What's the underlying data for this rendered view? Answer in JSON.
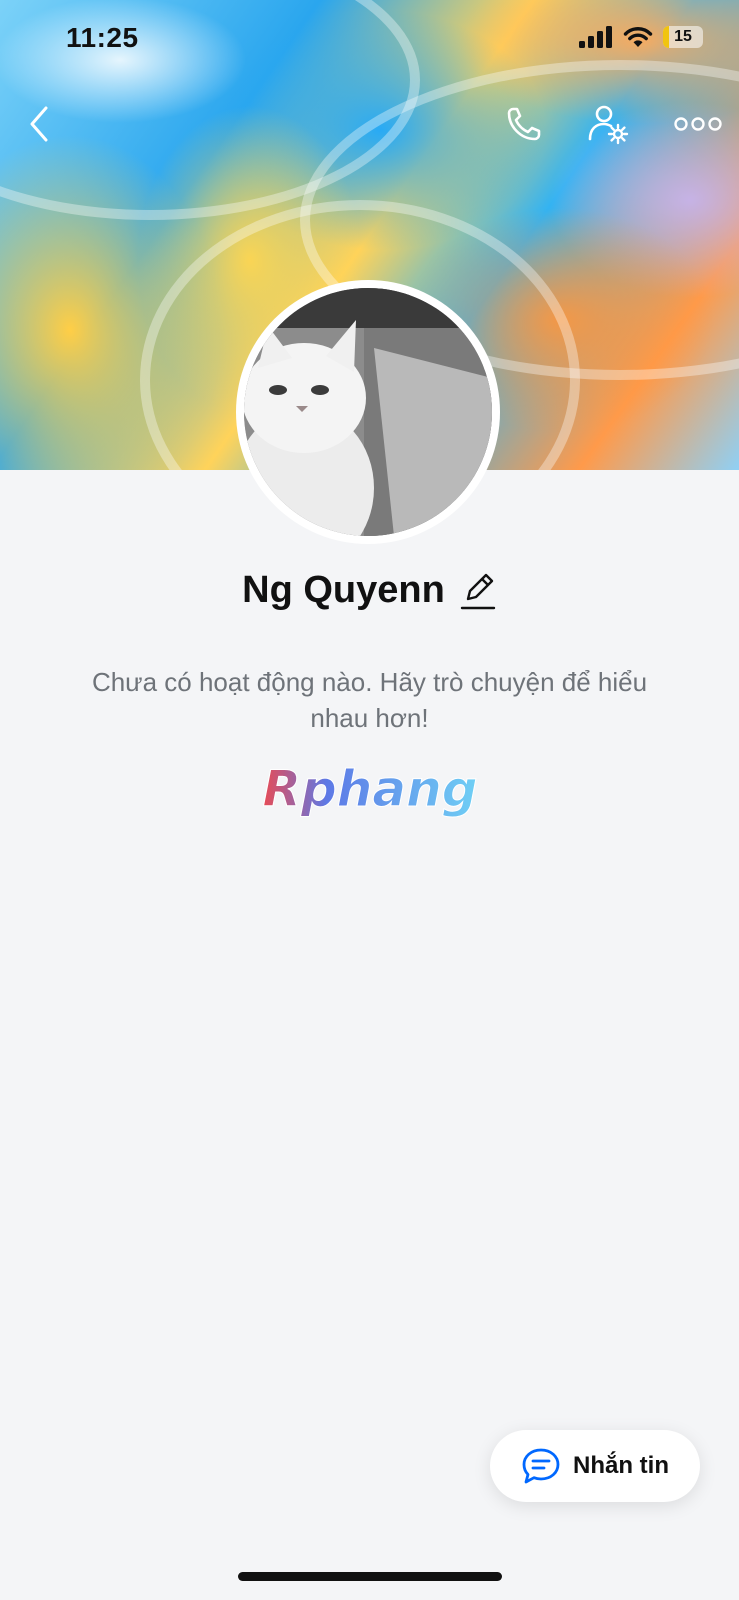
{
  "status_bar": {
    "time": "11:25",
    "battery_level": "15",
    "battery_fraction": 0.15
  },
  "header": {
    "back_icon": "chevron-left-icon",
    "call_icon": "phone-icon",
    "settings_icon": "user-settings-icon",
    "more_icon": "more-horizontal-icon"
  },
  "profile": {
    "name": "Ng Quyenn",
    "edit_icon": "pencil-icon",
    "empty_activity_text": "Chưa có hoạt động nào. Hãy trò chuyện để hiểu nhau hơn!"
  },
  "watermark": {
    "text": "Rphang"
  },
  "actions": {
    "message_label": "Nhắn tin",
    "message_icon": "chat-bubble-icon"
  },
  "colors": {
    "accent": "#0068ff",
    "background": "#f4f5f7",
    "text_primary": "#111111",
    "text_secondary": "#6e7379",
    "battery_low": "#f1c40f"
  }
}
